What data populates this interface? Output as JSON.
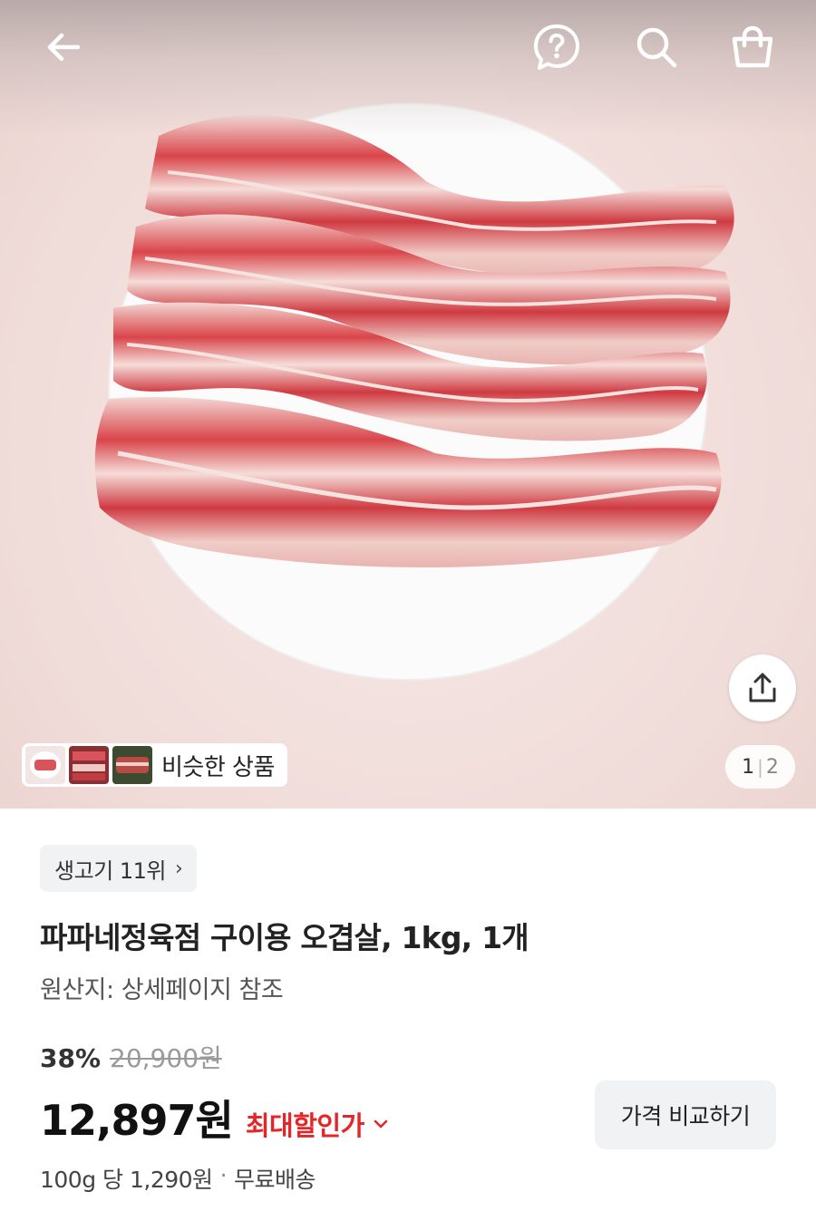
{
  "icons": {
    "back": "arrow-left-icon",
    "help": "question-bubble-icon",
    "search": "search-icon",
    "cart": "shopping-bag-icon",
    "share": "share-icon",
    "chevron": "chevron-down-icon"
  },
  "gallery": {
    "current": "1",
    "separator": "|",
    "total": "2",
    "similar_label": "비슷한 상품"
  },
  "product": {
    "rank_badge": "생고기 11위",
    "rank_chevron": "›",
    "title": "파파네정육점 구이용 오겹살, 1kg, 1개",
    "origin": "원산지: 상세페이지 참조",
    "discount_rate": "38%",
    "original_price": "20,900원",
    "price": "12,897원",
    "max_discount_label": "최대할인가",
    "compare_button": "가격 비교하기",
    "unit_price": "100g 당 1,290원",
    "separator": "·",
    "shipping": "무료배송"
  },
  "colors": {
    "accent_red": "#e52528",
    "badge_bg": "#f1f2f4"
  }
}
